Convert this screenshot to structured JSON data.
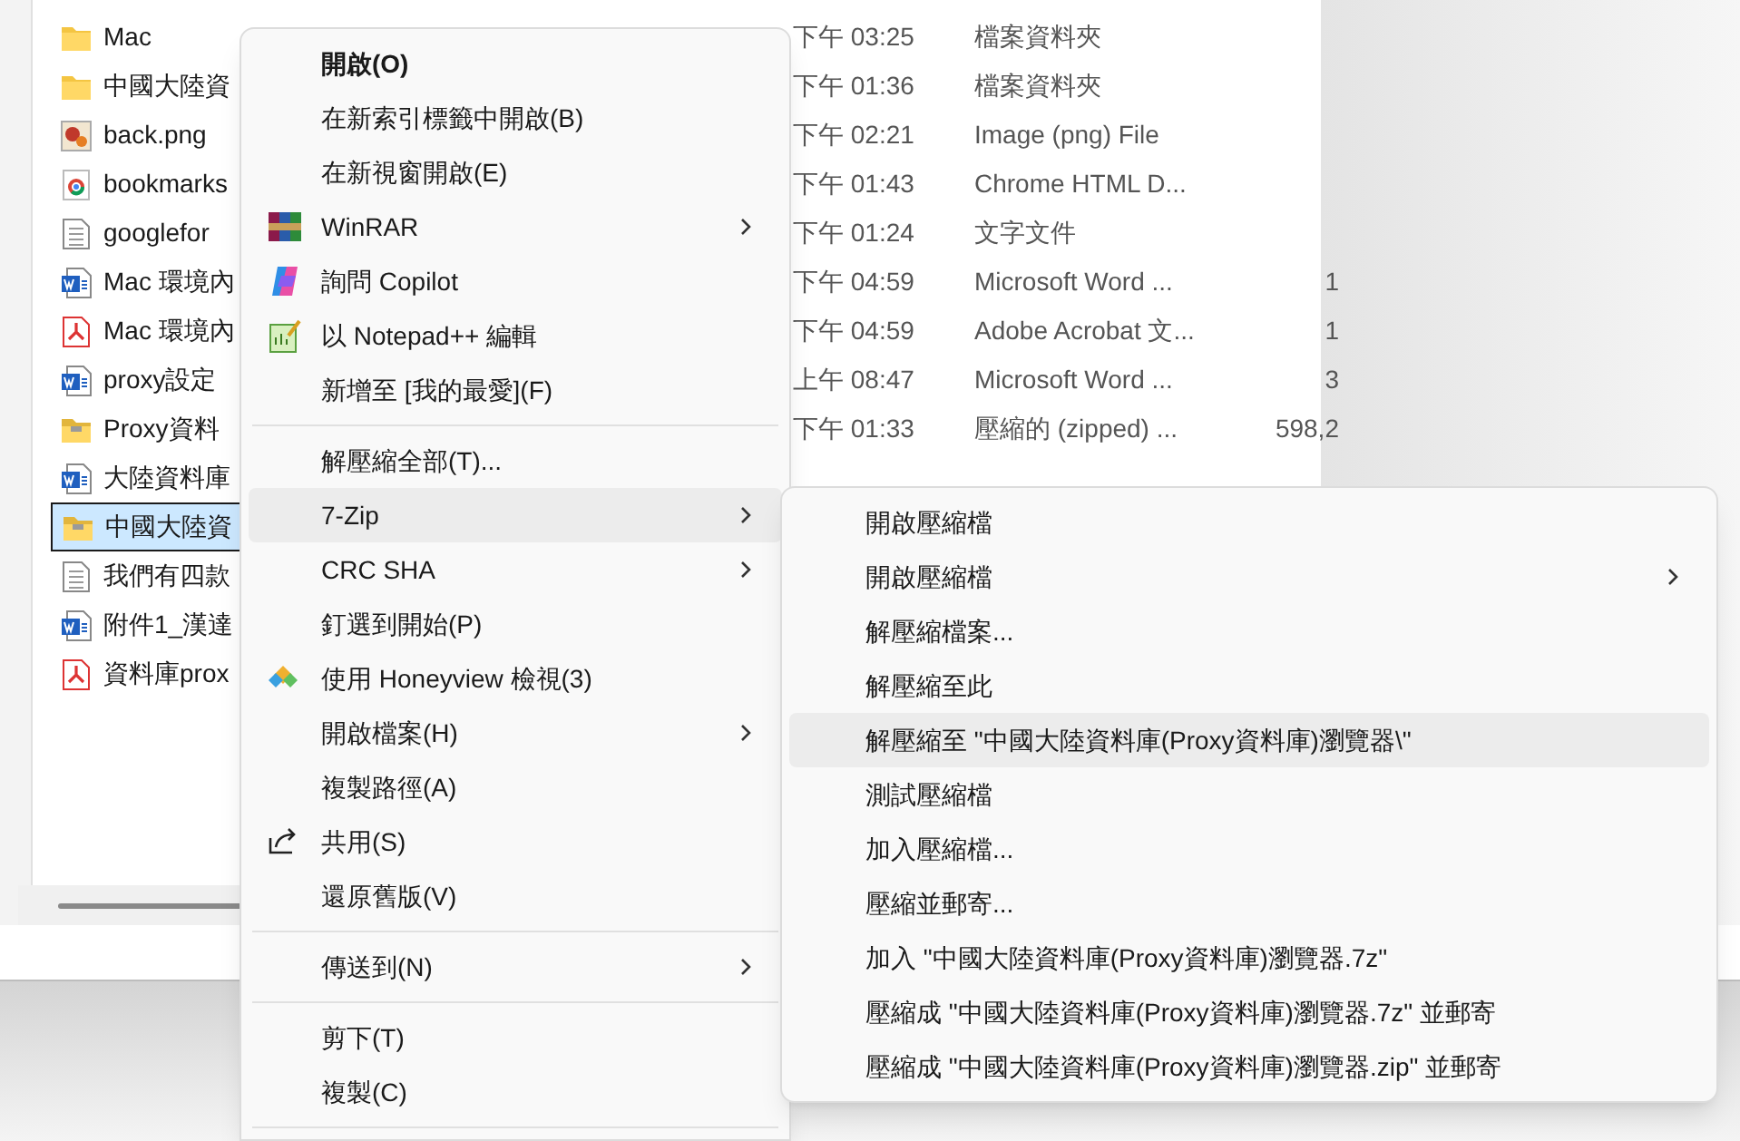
{
  "files": [
    {
      "name": "Mac",
      "kind": "folder",
      "date": "下午 03:25",
      "type": "檔案資料夾",
      "selected": false
    },
    {
      "name": "中國大陸資",
      "kind": "folder",
      "date": "下午 01:36",
      "type": "檔案資料夾",
      "selected": false
    },
    {
      "name": "back.png",
      "kind": "image",
      "date": "下午 02:21",
      "type": "Image (png) File",
      "selected": false
    },
    {
      "name": "bookmarks",
      "kind": "chrome",
      "date": "下午 01:43",
      "type": "Chrome HTML D...",
      "selected": false
    },
    {
      "name": "googlefor",
      "kind": "text",
      "date": "下午 01:24",
      "type": "文字文件",
      "selected": false
    },
    {
      "name": "Mac 環境內",
      "kind": "word",
      "date": "下午 04:59",
      "type": "Microsoft Word ...",
      "size": "1",
      "selected": false
    },
    {
      "name": "Mac 環境內",
      "kind": "pdf",
      "date": "下午 04:59",
      "type": "Adobe Acrobat 文...",
      "size": "1",
      "selected": false
    },
    {
      "name": "proxy設定",
      "kind": "word",
      "date": "上午 08:47",
      "type": "Microsoft Word ...",
      "size": "3",
      "selected": false
    },
    {
      "name": "Proxy資料",
      "kind": "zip",
      "date": "下午 01:33",
      "type": "壓縮的 (zipped) ...",
      "size": "598,2",
      "selected": false
    },
    {
      "name": "大陸資料庫",
      "kind": "word",
      "selected": false
    },
    {
      "name": "中國大陸資",
      "kind": "zip",
      "selected": true
    },
    {
      "name": "我們有四款",
      "kind": "text",
      "selected": false
    },
    {
      "name": "附件1_漢達",
      "kind": "word",
      "selected": false
    },
    {
      "name": "資料庫prox",
      "kind": "pdf",
      "selected": false
    }
  ],
  "context_menu": {
    "items": [
      {
        "kind": "item",
        "label": "開啟(O)",
        "bold": true
      },
      {
        "kind": "item",
        "label": "在新索引標籤中開啟(B)"
      },
      {
        "kind": "item",
        "label": "在新視窗開啟(E)"
      },
      {
        "kind": "winrar",
        "label": "WinRAR",
        "submenu": true
      },
      {
        "kind": "copilot",
        "label": "詢問 Copilot"
      },
      {
        "kind": "notepad",
        "label": "以 Notepad++ 編輯"
      },
      {
        "kind": "item",
        "label": "新增至 [我的最愛](F)"
      },
      {
        "kind": "separator"
      },
      {
        "kind": "item",
        "label": "解壓縮全部(T)..."
      },
      {
        "kind": "item",
        "label": "7-Zip",
        "submenu": true,
        "selected": true
      },
      {
        "kind": "item",
        "label": "CRC SHA",
        "submenu": true
      },
      {
        "kind": "item",
        "label": "釘選到開始(P)"
      },
      {
        "kind": "honeyview",
        "label": "使用 Honeyview 檢視(3)"
      },
      {
        "kind": "item",
        "label": "開啟檔案(H)",
        "submenu": true
      },
      {
        "kind": "item",
        "label": "複製路徑(A)"
      },
      {
        "kind": "share",
        "label": "共用(S)"
      },
      {
        "kind": "item",
        "label": "還原舊版(V)"
      },
      {
        "kind": "separator"
      },
      {
        "kind": "item",
        "label": "傳送到(N)",
        "submenu": true
      },
      {
        "kind": "separator"
      },
      {
        "kind": "item",
        "label": "剪下(T)"
      },
      {
        "kind": "item",
        "label": "複製(C)"
      },
      {
        "kind": "separator"
      }
    ]
  },
  "submenu": {
    "items": [
      {
        "label": "開啟壓縮檔",
        "selected": false
      },
      {
        "label": "開啟壓縮檔",
        "submenu": true,
        "selected": false
      },
      {
        "label": "解壓縮檔案...",
        "selected": false
      },
      {
        "label": "解壓縮至此",
        "selected": false
      },
      {
        "label": "解壓縮至 \"中國大陸資料庫(Proxy資料庫)瀏覽器\\\"",
        "selected": true
      },
      {
        "label": "測試壓縮檔",
        "selected": false
      },
      {
        "label": "加入壓縮檔...",
        "selected": false
      },
      {
        "label": "壓縮並郵寄...",
        "selected": false
      },
      {
        "label": "加入 \"中國大陸資料庫(Proxy資料庫)瀏覽器.7z\"",
        "selected": false
      },
      {
        "label": "壓縮成 \"中國大陸資料庫(Proxy資料庫)瀏覽器.7z\" 並郵寄",
        "selected": false
      },
      {
        "label": "壓縮成 \"中國大陸資料庫(Proxy資料庫)瀏覽器.zip\" 並郵寄",
        "selected": false
      }
    ]
  }
}
